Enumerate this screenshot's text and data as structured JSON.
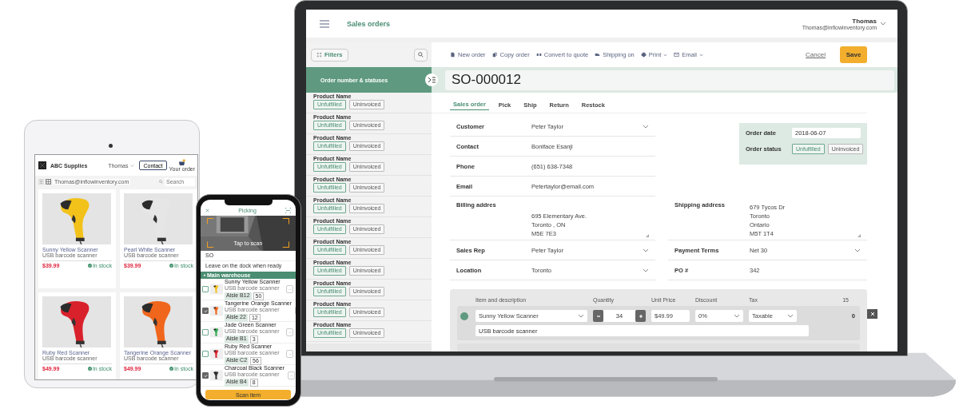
{
  "laptop": {
    "header": {
      "title": "Sales orders",
      "user_name": "Thomas",
      "user_email": "Thomas@inflowinventory.com"
    },
    "sidebar": {
      "filters_label": "Filters",
      "list_header": "Order number & statuses",
      "orders": [
        {
          "name": "Product Name",
          "fulfillment": "Unfulfilled",
          "invoice": "Uninvoiced"
        },
        {
          "name": "Product Name",
          "fulfillment": "Unfulfilled",
          "invoice": "Uninvoiced"
        },
        {
          "name": "Product Name",
          "fulfillment": "Unfulfilled",
          "invoice": "Uninvoiced"
        },
        {
          "name": "Product Name",
          "fulfillment": "Unfulfilled",
          "invoice": "Uninvoiced"
        },
        {
          "name": "Product Name",
          "fulfillment": "Unfulfilled",
          "invoice": "Uninvoiced"
        },
        {
          "name": "Product Name",
          "fulfillment": "Unfulfilled",
          "invoice": "Uninvoiced"
        },
        {
          "name": "Product Name",
          "fulfillment": "Unfulfilled",
          "invoice": "Uninvoiced"
        },
        {
          "name": "Product Name",
          "fulfillment": "Unfulfilled",
          "invoice": "Uninvoiced"
        },
        {
          "name": "Product Name",
          "fulfillment": "Unfulfilled",
          "invoice": "Uninvoiced"
        },
        {
          "name": "Product Name",
          "fulfillment": "Unfulfilled",
          "invoice": "Uninvoiced"
        },
        {
          "name": "Product Name",
          "fulfillment": "Unfulfilled",
          "invoice": "Uninvoiced"
        },
        {
          "name": "Product Name",
          "fulfillment": "Unfulfilled",
          "invoice": "Uninvoiced"
        }
      ]
    },
    "toolbar": {
      "actions": [
        {
          "label": "New order",
          "kind": "document",
          "dropdown": false
        },
        {
          "label": "Copy order",
          "kind": "copy",
          "dropdown": false
        },
        {
          "label": "Convert to quote",
          "kind": "convert",
          "dropdown": false
        },
        {
          "label": "Shipping on",
          "kind": "truck",
          "dropdown": false
        },
        {
          "label": "Print",
          "kind": "printer",
          "dropdown": true
        },
        {
          "label": "Email",
          "kind": "mail",
          "dropdown": true
        }
      ],
      "cancel": "Cancel",
      "save": "Save"
    },
    "order_number": "SO-000012",
    "tabs": [
      {
        "label": "Sales order",
        "selected": true
      },
      {
        "label": "Pick",
        "selected": false
      },
      {
        "label": "Ship",
        "selected": false
      },
      {
        "label": "Return",
        "selected": false
      },
      {
        "label": "Restock",
        "selected": false
      }
    ],
    "contact_fields": [
      {
        "label": "Customer",
        "kind": "select",
        "lines": [
          "Peter Taylor"
        ]
      },
      {
        "label": "Contact",
        "kind": "text",
        "lines": [
          "Boniface Esanji"
        ]
      },
      {
        "label": "Phone",
        "kind": "text",
        "lines": [
          "(651) 638-7348"
        ]
      },
      {
        "label": "Email",
        "kind": "text",
        "lines": [
          "Petertaylor@email.com"
        ]
      }
    ],
    "order_info": {
      "date_label": "Order date",
      "date": "2018-06-07",
      "status_label": "Order status",
      "fulfillment": "Unfulfilled",
      "invoice": "Uninvoiced"
    },
    "paired_fields": [
      {
        "label": "Billing addres",
        "kind": "address",
        "lines": [
          "695 Elementary Ave.",
          "Toronto , ON",
          "M5E 7E3"
        ]
      },
      {
        "label": "Shipping address",
        "kind": "address",
        "lines": [
          "679 Tycos Dr",
          "Toronto",
          "Ontario",
          "M5T 1T4"
        ]
      },
      {
        "label": "Sales Rep",
        "kind": "select",
        "lines": [
          "Peter Taylor"
        ]
      },
      {
        "label": "Payment Terms",
        "kind": "select",
        "lines": [
          "Net 30"
        ]
      },
      {
        "label": "Location",
        "kind": "select",
        "lines": [
          "Toronto"
        ]
      },
      {
        "label": "PO #",
        "kind": "text",
        "lines": [
          "342"
        ]
      }
    ],
    "line_items": {
      "columns": [
        "Item and description",
        "Quantity",
        "Unit Price",
        "Discount",
        "Tax",
        "15"
      ],
      "rows": [
        {
          "item": "Sunny Yellow Scanner",
          "description": "USB barcode scanner",
          "quantity": "34",
          "unit_price": "$49.99",
          "discount": "0%",
          "tax": "Taxable",
          "total": "0"
        }
      ]
    }
  },
  "tablet": {
    "store": "ABC Supplies",
    "user": "Thomas",
    "contact_button": "Contact",
    "cart_label": "Your order",
    "email": "Thomas@inflowinventory.com",
    "search_placeholder": "Search",
    "products": [
      {
        "name": "Sunny Yellow Scanner",
        "subtitle": "USB barcode scanner",
        "price": "$39.99",
        "stock": "In stock",
        "color": "#f2c21b"
      },
      {
        "name": "Pearl White Scanner",
        "subtitle": "USB barcode scanner",
        "price": "$39.99",
        "stock": "In stock",
        "color": "#e6e6e6"
      },
      {
        "name": "Ruby Red Scanner",
        "subtitle": "USB barcode scanner",
        "price": "$49.99",
        "stock": "In stock",
        "color": "#d9212b"
      },
      {
        "name": "Tangerine Orange Scanner",
        "subtitle": "USB barcode scanner",
        "price": "$49.99",
        "stock": "In stock",
        "color": "#f0661c"
      }
    ]
  },
  "phone": {
    "title": "Picking",
    "scan_hint": "Tap to scan",
    "order_field": "SO",
    "note": "Leave on the dock when ready",
    "section": "Main warehouse",
    "scan_button": "Scan item",
    "items": [
      {
        "name": "Sunny Yellow Scanner",
        "subtitle": "USB barcode scanner",
        "location": "Aisle B12",
        "quantity": "50",
        "checked": false,
        "color": "#f2c21b"
      },
      {
        "name": "Tangerine Orange Scanner",
        "subtitle": "USB barcode scanner",
        "location": "Aisle 22",
        "quantity": "12",
        "checked": true,
        "color": "#f0661c"
      },
      {
        "name": "Jade Green Scanner",
        "subtitle": "USB barcode scanner",
        "location": "Aisle B1",
        "quantity": "3",
        "checked": false,
        "color": "#2fa84f"
      },
      {
        "name": "Ruby Red Scanner",
        "subtitle": "USB barcode scanner",
        "location": "Aisle C2",
        "quantity": "56",
        "checked": false,
        "color": "#d9212b"
      },
      {
        "name": "Charcoal Black Scanner",
        "subtitle": "USB barcode scanner",
        "location": "Aisle B4",
        "quantity": "8",
        "checked": true,
        "color": "#333333"
      }
    ]
  }
}
